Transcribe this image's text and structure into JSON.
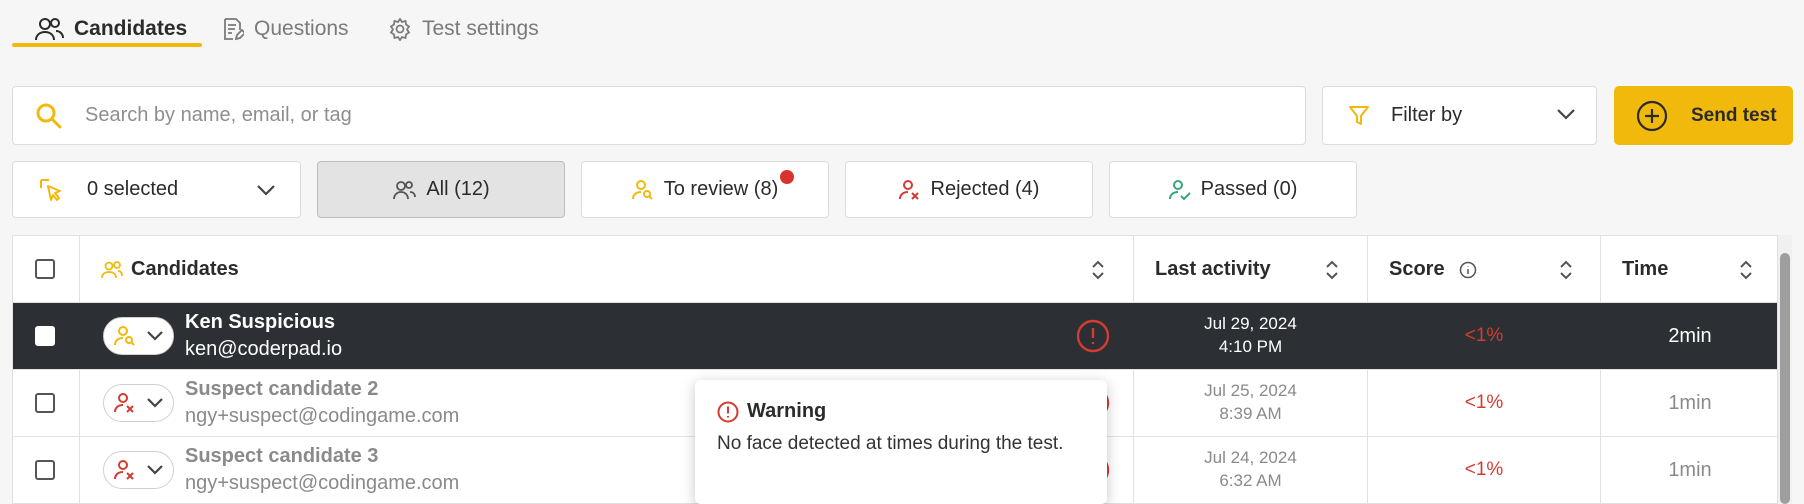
{
  "tabs": [
    {
      "label": "Candidates",
      "icon": "users-icon",
      "active": true
    },
    {
      "label": "Questions",
      "icon": "document-edit-icon",
      "active": false
    },
    {
      "label": "Test settings",
      "icon": "gear-icon",
      "active": false
    }
  ],
  "search": {
    "placeholder": "Search by name, email, or tag",
    "value": ""
  },
  "filter": {
    "label": "Filter by"
  },
  "send_test": {
    "label": "Send test"
  },
  "selection": {
    "label": "0 selected"
  },
  "segments": [
    {
      "label": "All (12)",
      "icon": "users-icon",
      "active": true
    },
    {
      "label": "To review (8)",
      "icon": "user-search-icon",
      "active": false,
      "has_notification": true
    },
    {
      "label": "Rejected (4)",
      "icon": "user-x-icon",
      "active": false
    },
    {
      "label": "Passed (0)",
      "icon": "user-check-icon",
      "active": false
    }
  ],
  "table": {
    "headers": {
      "candidates": "Candidates",
      "last_activity": "Last activity",
      "score": "Score",
      "time": "Time"
    },
    "rows": [
      {
        "name": "Ken Suspicious",
        "email": "ken@coderpad.io",
        "status": "to-review",
        "date": "Jul 29, 2024",
        "clock": "4:10 PM",
        "score": "<1%",
        "time": "2min",
        "highlighted": true
      },
      {
        "name": "Suspect candidate 2",
        "email": "ngy+suspect@codingame.com",
        "status": "rejected",
        "date": "Jul 25, 2024",
        "clock": "8:39 AM",
        "score": "<1%",
        "time": "1min",
        "highlighted": false
      },
      {
        "name": "Suspect candidate 3",
        "email": "ngy+suspect@codingame.com",
        "status": "rejected",
        "date": "Jul 24, 2024",
        "clock": "6:32 AM",
        "score": "<1%",
        "time": "1min",
        "highlighted": false
      }
    ]
  },
  "tooltip": {
    "title": "Warning",
    "body": "No face detected at times during the test."
  },
  "colors": {
    "accent": "#f2b90d",
    "danger": "#d43c32",
    "success": "#3aa57a",
    "dark_row": "#2c2f33"
  }
}
